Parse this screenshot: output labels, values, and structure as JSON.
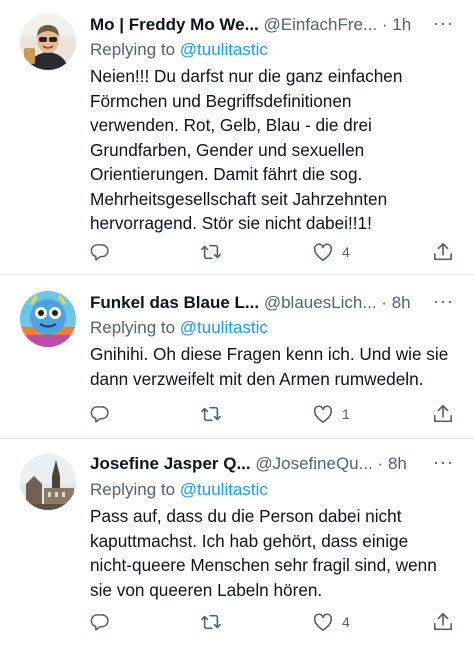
{
  "tweets": [
    {
      "name": "Mo | Freddy Mo We...",
      "handle": "@EinfachFre...",
      "dot": "·",
      "time": "1h",
      "more": "···",
      "reply_prefix": "Replying to ",
      "reply_to": "@tuulitastic",
      "lines": [
        "Neien!!! Du darfst nur die ganz einfachen",
        "Förmchen und Begriffsdefinitionen",
        "verwenden. Rot, Gelb, Blau - die drei",
        "Grundfarben, Gender und sexuellen",
        "Orientierungen. Damit fährt die sog.",
        "Mehrheitsgesellschaft seit Jahrzehnten",
        "hervorragend. Stör sie nicht dabei!!1!"
      ],
      "replies": "",
      "retweets": "",
      "likes": "4"
    },
    {
      "name": "Funkel das Blaue L...",
      "handle": "@blauesLich...",
      "dot": "·",
      "time": "8h",
      "more": "···",
      "reply_prefix": "Replying to ",
      "reply_to": "@tuulitastic",
      "lines": [
        "Gnihihi. Oh diese Fragen kenn ich. Und wie sie",
        "dann verzweifelt mit den Armen rumwedeln."
      ],
      "replies": "",
      "retweets": "",
      "likes": "1"
    },
    {
      "name": "Josefine Jasper Q...",
      "handle": "@JosefineQu...",
      "dot": "·",
      "time": "8h",
      "more": "···",
      "reply_prefix": "Replying to ",
      "reply_to": "@tuulitastic",
      "lines": [
        "Pass auf, dass du die Person dabei nicht",
        "kaputtmachst. Ich hab gehört, dass einige",
        "nicht-queere Menschen sehr fragil sind, wenn",
        "sie von queeren Labeln hören."
      ],
      "replies": "",
      "retweets": "",
      "likes": "4"
    }
  ],
  "icons": {
    "reply": "reply-icon",
    "retweet": "retweet-icon",
    "like": "heart-icon",
    "share": "share-icon"
  },
  "colors": {
    "text": "#0f1419",
    "secondary": "#536471",
    "accent": "#1d9bf0",
    "divider": "#e6e9ec"
  }
}
